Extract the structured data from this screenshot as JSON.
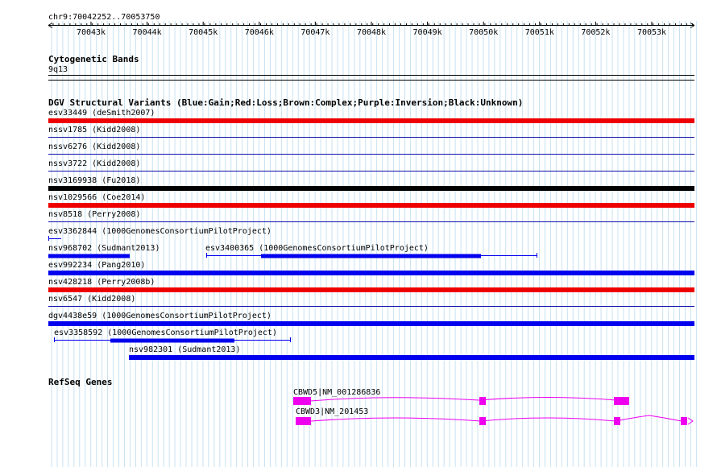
{
  "ruler": {
    "position": "chr9:70042252..70053750",
    "ticks": [
      {
        "kb": 43,
        "label": "70043k"
      },
      {
        "kb": 44,
        "label": "70044k"
      },
      {
        "kb": 45,
        "label": "70045k"
      },
      {
        "kb": 46,
        "label": "70046k"
      },
      {
        "kb": 47,
        "label": "70047k"
      },
      {
        "kb": 48,
        "label": "70048k"
      },
      {
        "kb": 49,
        "label": "70049k"
      },
      {
        "kb": 50,
        "label": "70050k"
      },
      {
        "kb": 51,
        "label": "70051k"
      },
      {
        "kb": 52,
        "label": "70052k"
      },
      {
        "kb": 53,
        "label": "70053k"
      }
    ]
  },
  "cyto": {
    "title": "Cytogenetic Bands",
    "band": "9q13"
  },
  "dgv": {
    "title": "DGV Structural Variants (Blue:Gain;Red:Loss;Brown:Complex;Purple:Inversion;Black:Unknown)",
    "colors": {
      "gain": "#0000ee",
      "loss": "#ee0000",
      "unknown": "#000000",
      "inversion": "#1010aa"
    },
    "variants": [
      {
        "label": "esv33449 (deSmith2007)",
        "type": "loss"
      },
      {
        "label": "nssv1785 (Kidd2008)",
        "type": "inversion"
      },
      {
        "label": "nssv6276 (Kidd2008)",
        "type": "inversion"
      },
      {
        "label": "nssv3722 (Kidd2008)",
        "type": "inversion"
      },
      {
        "label": "nsv3169938 (Fu2018)",
        "type": "unknown"
      },
      {
        "label": "nsv1029566 (Coe2014)",
        "type": "loss"
      },
      {
        "label": "nsv8518 (Perry2008)",
        "type": "inversion"
      },
      {
        "label": "esv3362844 (1000GenomesConsortiumPilotProject)",
        "type": "gain"
      },
      {
        "label": "nsv968702 (Sudmant2013)",
        "type": "gain"
      },
      {
        "label": "esv3400365 (1000GenomesConsortiumPilotProject)",
        "type": "gain"
      },
      {
        "label": "esv992234 (Pang2010)",
        "type": "gain"
      },
      {
        "label": "nsv428218 (Perry2008b)",
        "type": "loss"
      },
      {
        "label": "nsv6547 (Kidd2008)",
        "type": "inversion"
      },
      {
        "label": "dgv4438e59 (1000GenomesConsortiumPilotProject)",
        "type": "gain"
      },
      {
        "label": "esv3358592 (1000GenomesConsortiumPilotProject)",
        "type": "gain"
      },
      {
        "label": "nsv982301 (Sudmant2013)",
        "type": "gain"
      }
    ]
  },
  "refseq": {
    "title": "RefSeq Genes",
    "color": "#ee00ee",
    "genes": [
      {
        "label": "CBWD5|NM_001286836"
      },
      {
        "label": "CBWD3|NM_201453"
      }
    ]
  }
}
